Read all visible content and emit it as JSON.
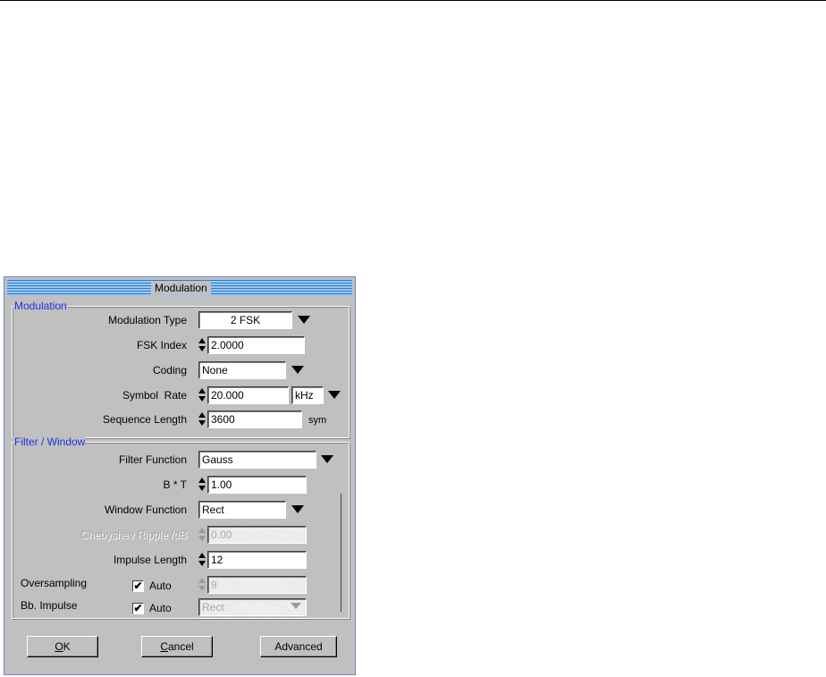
{
  "dialog": {
    "title": "Modulation"
  },
  "modulation": {
    "group_label": "Modulation",
    "type_label": "Modulation Type",
    "type_value": "2 FSK",
    "fsk_index_label": "FSK Index",
    "fsk_index_value": "2.0000",
    "coding_label": "Coding",
    "coding_value": "None",
    "symbol_rate_label": "Symbol  Rate",
    "symbol_rate_value": "20.000",
    "symbol_rate_unit": "kHz",
    "sequence_length_label": "Sequence Length",
    "sequence_length_value": "3600",
    "sequence_length_unit": "sym"
  },
  "filter": {
    "group_label": "Filter / Window",
    "function_label": "Filter Function",
    "function_value": "Gauss",
    "bt_label": "B * T",
    "bt_value": "1.00",
    "window_label": "Window Function",
    "window_value": "Rect",
    "cheby_label": "Chebyshev Ripple /dB",
    "cheby_value": "0.00",
    "impulse_label": "Impulse Length",
    "impulse_value": "12",
    "oversampling_label": "Oversampling",
    "oversampling_auto": "Auto",
    "oversampling_value": "9",
    "bb_impulse_label": "Bb. Impulse",
    "bb_impulse_auto": "Auto",
    "bb_impulse_value": "Rect"
  },
  "buttons": {
    "ok_mn": "O",
    "ok_rest": "K",
    "cancel_mn": "C",
    "cancel_rest": "ancel",
    "advanced": "Advanced"
  },
  "checkmark": "✔"
}
